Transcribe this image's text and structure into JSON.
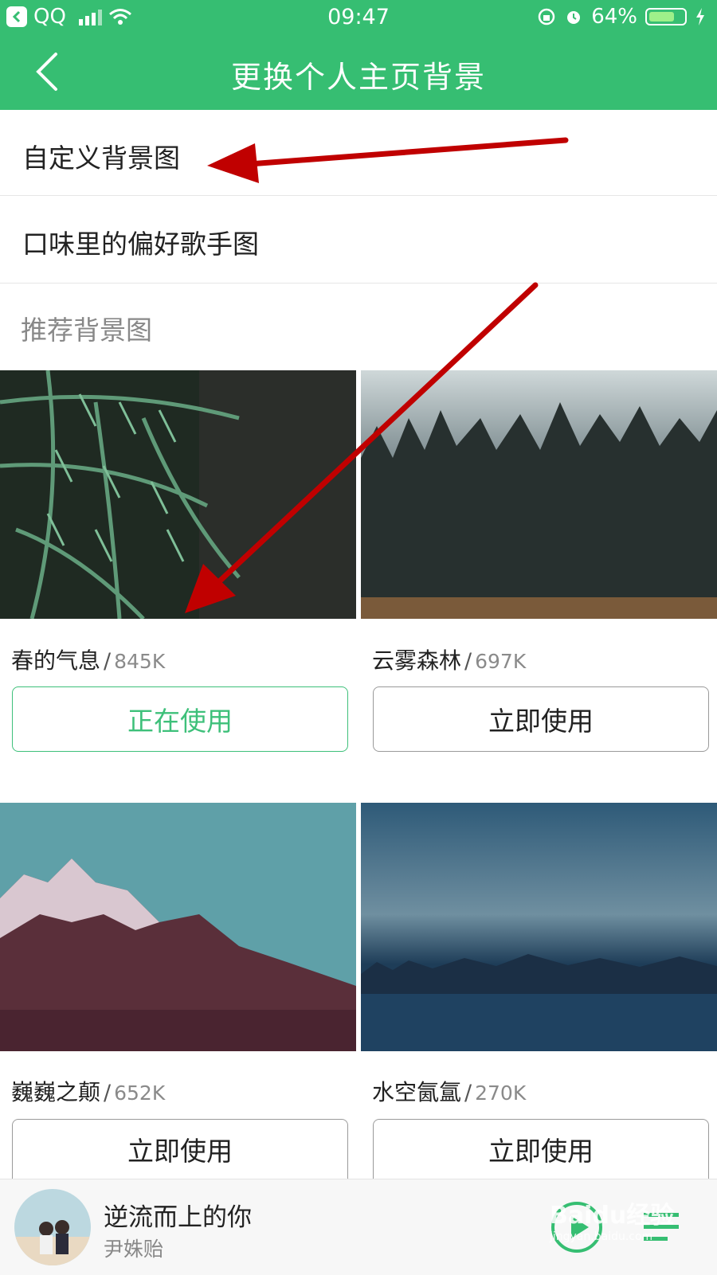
{
  "status_bar": {
    "carrier": "QQ",
    "time": "09:47",
    "battery": "64%"
  },
  "header": {
    "title": "更换个人主页背景"
  },
  "menu": {
    "custom": "自定义背景图",
    "singer": "口味里的偏好歌手图"
  },
  "section": {
    "recommended": "推荐背景图"
  },
  "backgrounds": [
    {
      "name": "春的气息",
      "size": "845K",
      "button": "正在使用",
      "active": true
    },
    {
      "name": "云雾森林",
      "size": "697K",
      "button": "立即使用",
      "active": false
    },
    {
      "name": "巍巍之颠",
      "size": "652K",
      "button": "立即使用",
      "active": false
    },
    {
      "name": "水空氤氲",
      "size": "270K",
      "button": "立即使用",
      "active": false
    }
  ],
  "separator": "/",
  "player": {
    "song": "逆流而上的你",
    "artist": "尹姝贻"
  },
  "watermark": {
    "text": "Baidu经验",
    "url": "jingyan.baidu.com"
  },
  "colors": {
    "brand_green": "#36be72",
    "annotation_arrow": "#c00000"
  }
}
